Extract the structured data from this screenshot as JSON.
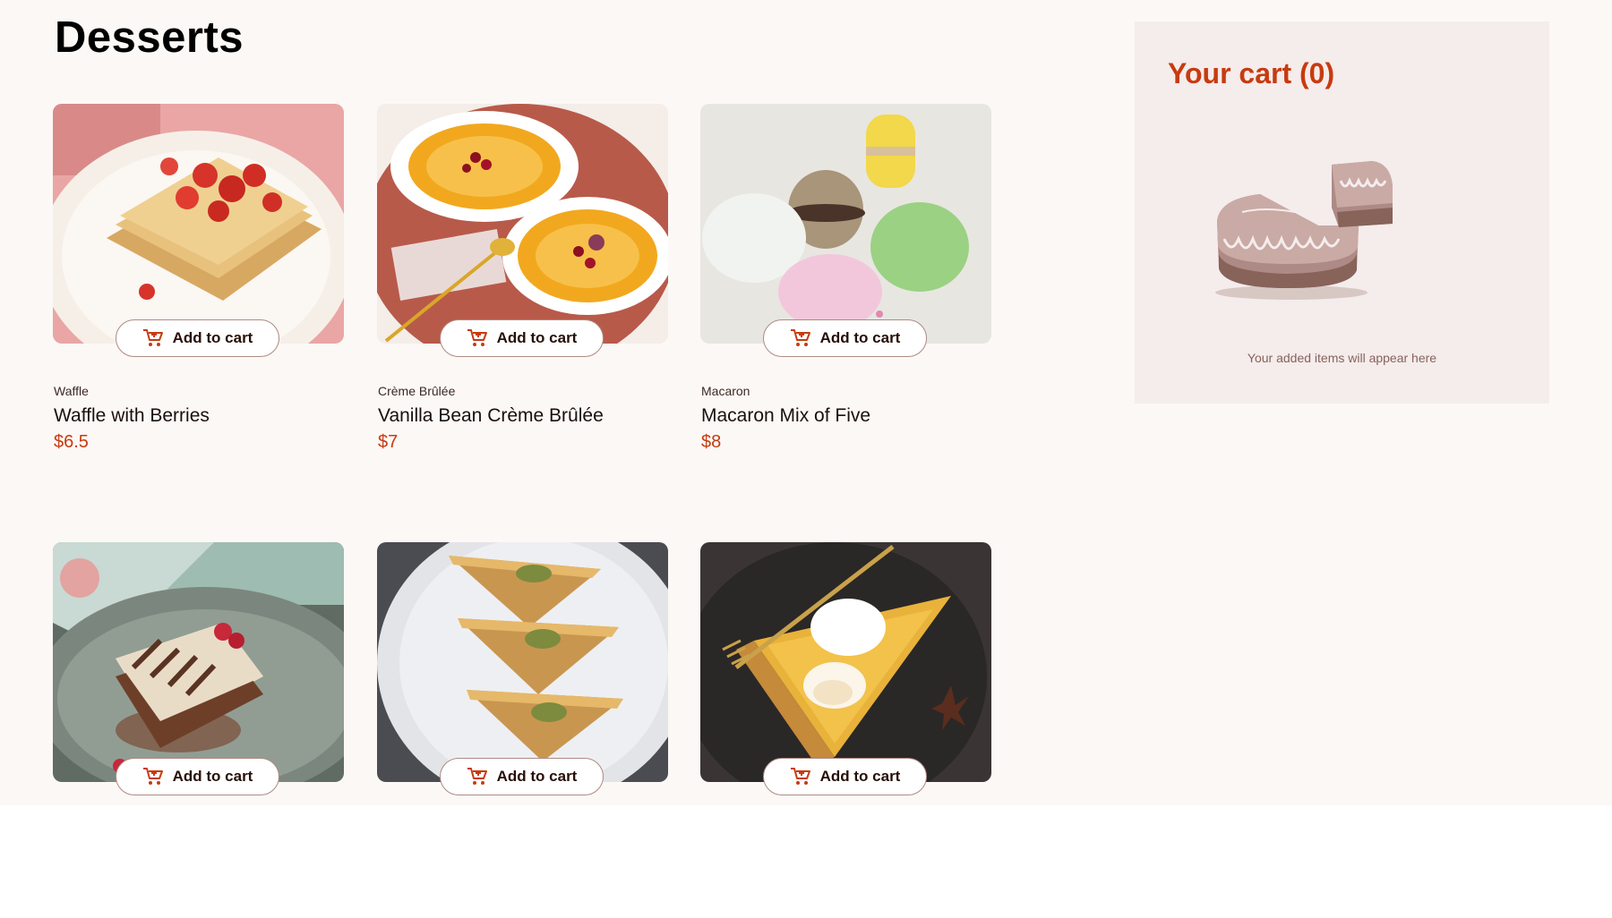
{
  "page": {
    "title": "Desserts"
  },
  "products": [
    {
      "category": "Waffle",
      "name": "Waffle with Berries",
      "price": "$6.5",
      "image": "waffle-image",
      "button_label": "Add to cart"
    },
    {
      "category": "Crème Brûlée",
      "name": "Vanilla Bean Crème Brûlée",
      "price": "$7",
      "image": "creme-brulee-image",
      "button_label": "Add to cart"
    },
    {
      "category": "Macaron",
      "name": "Macaron Mix of Five",
      "price": "$8",
      "image": "macaron-image",
      "button_label": "Add to cart"
    },
    {
      "category": "",
      "name": "",
      "price": "",
      "image": "tiramisu-image",
      "button_label": "Add to cart"
    },
    {
      "category": "",
      "name": "",
      "price": "",
      "image": "baklava-image",
      "button_label": "Add to cart"
    },
    {
      "category": "",
      "name": "",
      "price": "",
      "image": "pie-image",
      "button_label": "Add to cart"
    }
  ],
  "cart": {
    "title": "Your cart (0)",
    "empty_message": "Your added items will appear here",
    "illustration": "empty-cart-cake-illustration"
  },
  "icons": {
    "add_to_cart": "add-to-cart-icon"
  },
  "colors": {
    "accent": "#c73b0f",
    "background": "#fcf8f6",
    "cart_panel": "#f5ecec",
    "text_dark": "#260f08"
  }
}
